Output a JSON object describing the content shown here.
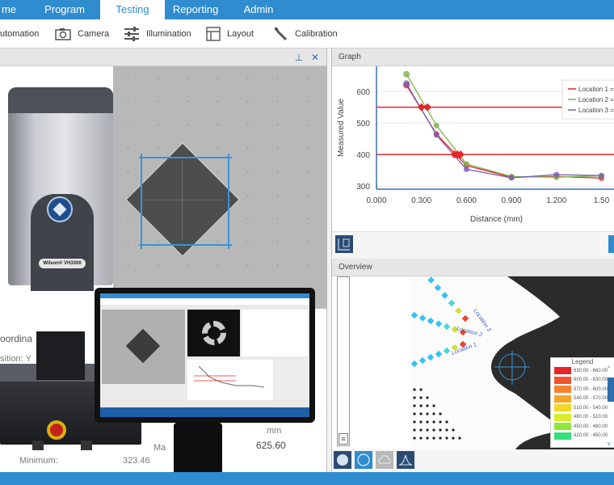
{
  "tabs": [
    {
      "label": "me",
      "active": false
    },
    {
      "label": "Program",
      "active": false
    },
    {
      "label": "Testing",
      "active": true
    },
    {
      "label": "Reporting",
      "active": false
    },
    {
      "label": "Admin",
      "active": false
    }
  ],
  "toolbar": {
    "items": [
      {
        "label": "utomation",
        "icon": "automation-icon"
      },
      {
        "label": "Camera",
        "icon": "camera-icon"
      },
      {
        "label": "Illumination",
        "icon": "sliders-icon"
      },
      {
        "label": "Layout",
        "icon": "layout-icon"
      },
      {
        "label": "Calibration",
        "icon": "wrench-icon"
      }
    ]
  },
  "left_panel": {
    "pin_glyph": "📌",
    "close_glyph": "✕",
    "machine_model": "Wilson® VH3300",
    "ghost_labels": {
      "coordinates": "oordina",
      "position": "sition: Y",
      "minimum_label": "Minimum:",
      "minimum_value": "323.46",
      "max_label": "Ma",
      "unit": "mm",
      "max_value": "625.60"
    }
  },
  "graph_panel": {
    "title": "Graph",
    "chart_data": {
      "type": "line",
      "xlabel": "Distance (mm)",
      "ylabel": "Measured Value",
      "xlim": [
        0,
        1.6
      ],
      "ylim": [
        290,
        680
      ],
      "x_ticks": [
        "0.000",
        "0.300",
        "0.600",
        "0.900",
        "1.200",
        "1.50"
      ],
      "x_tick_values": [
        0,
        0.3,
        0.6,
        0.9,
        1.2,
        1.5
      ],
      "y_ticks": [
        "300",
        "400",
        "500",
        "600"
      ],
      "y_tick_values": [
        300,
        400,
        500,
        600
      ],
      "thresholds": [
        550,
        400
      ],
      "threshold_color": "#e8262a",
      "crossings": [
        {
          "x": 0.3,
          "y": 550
        },
        {
          "x": 0.34,
          "y": 550
        },
        {
          "x": 0.52,
          "y": 400
        },
        {
          "x": 0.54,
          "y": 400
        },
        {
          "x": 0.56,
          "y": 400
        }
      ],
      "legend": [
        "Location 1 =",
        "Location 2 =",
        "Location 3 ="
      ],
      "series": [
        {
          "name": "Location 1",
          "color": "#e8262a",
          "x": [
            0.2,
            0.4,
            0.6,
            0.9,
            1.2,
            1.5
          ],
          "y": [
            620,
            465,
            365,
            328,
            330,
            325
          ]
        },
        {
          "name": "Location 2",
          "color": "#7fb24a",
          "x": [
            0.2,
            0.4,
            0.6,
            0.9,
            1.2,
            1.5
          ],
          "y": [
            655,
            492,
            370,
            330,
            328,
            332
          ]
        },
        {
          "name": "Location 3",
          "color": "#7a5fb0",
          "x": [
            0.2,
            0.4,
            0.6,
            0.9,
            1.2,
            1.5
          ],
          "y": [
            625,
            462,
            353,
            326,
            336,
            333
          ]
        }
      ]
    }
  },
  "overview_panel": {
    "title": "Overview",
    "location_labels": [
      "Location 3",
      "Location 2",
      "Location 1"
    ],
    "legend": {
      "title": "Legend",
      "rows": [
        {
          "range": "630.00 - 660.00",
          "color": "#e8262a"
        },
        {
          "range": "600.00 - 630.00",
          "color": "#f0542e"
        },
        {
          "range": "570.00 - 600.00",
          "color": "#f5822e"
        },
        {
          "range": "540.00 - 570.00",
          "color": "#f8a52c"
        },
        {
          "range": "510.00 - 540.00",
          "color": "#f5d62a"
        },
        {
          "range": "480.00 - 510.00",
          "color": "#d7ec2c"
        },
        {
          "range": "450.00 - 480.00",
          "color": "#8fe63c"
        },
        {
          "range": "420.00 - 450.00",
          "color": "#35e07a"
        }
      ]
    },
    "footer_buttons": [
      "fill-circle-icon",
      "outline-circle-icon",
      "cloud-icon",
      "bell-curve-icon"
    ]
  },
  "colors": {
    "accent": "#2f8ccf",
    "dark_button": "#2b4b73"
  }
}
